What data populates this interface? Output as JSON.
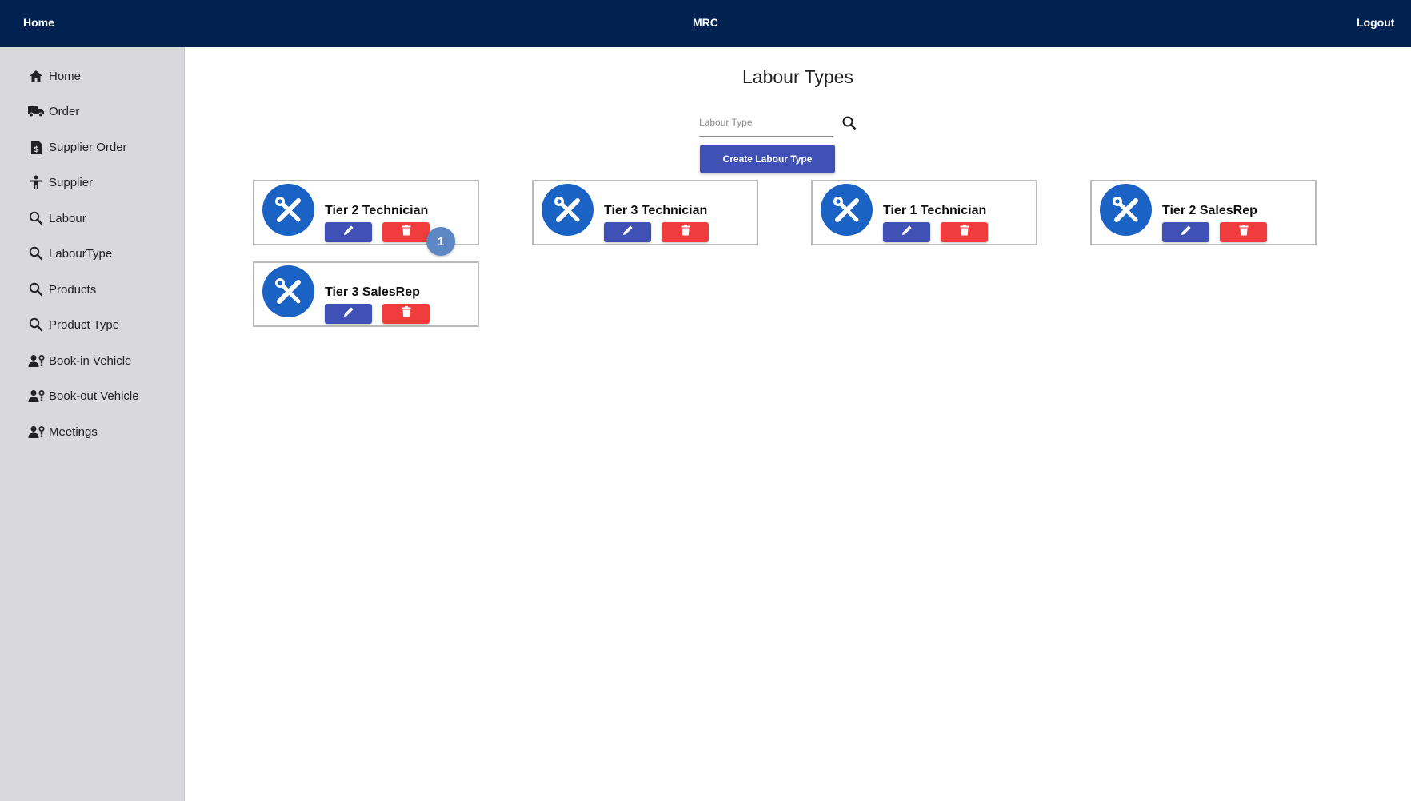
{
  "topbar": {
    "home": "Home",
    "title": "MRC",
    "logout": "Logout"
  },
  "sidebar": {
    "items": [
      {
        "label": "Home",
        "icon": "home-icon"
      },
      {
        "label": "Order",
        "icon": "truck-icon"
      },
      {
        "label": "Supplier Order",
        "icon": "invoice-icon"
      },
      {
        "label": "Supplier",
        "icon": "person-icon"
      },
      {
        "label": "Labour",
        "icon": "search-icon"
      },
      {
        "label": "LabourType",
        "icon": "search-icon"
      },
      {
        "label": "Products",
        "icon": "search-icon"
      },
      {
        "label": "Product Type",
        "icon": "search-icon"
      },
      {
        "label": "Book-in Vehicle",
        "icon": "user-gear-icon"
      },
      {
        "label": "Book-out Vehicle",
        "icon": "user-gear-icon"
      },
      {
        "label": "Meetings",
        "icon": "user-gear-icon"
      }
    ]
  },
  "main": {
    "title": "Labour Types",
    "search": {
      "placeholder": "Labour Type",
      "value": ""
    },
    "create_label": "Create Labour Type",
    "cards": [
      {
        "name": "Tier 2 Technician"
      },
      {
        "name": "Tier 3 Technician"
      },
      {
        "name": "Tier 1 Technician"
      },
      {
        "name": "Tier 2 SalesRep"
      },
      {
        "name": "Tier 3 SalesRep"
      }
    ],
    "badge": "1"
  },
  "colors": {
    "topbar": "#012150",
    "sidebar": "#d9d9dd",
    "primary": "#3f51b5",
    "danger": "#f03c3c",
    "avatar": "#1a63c4",
    "badge": "#5c86c4"
  }
}
